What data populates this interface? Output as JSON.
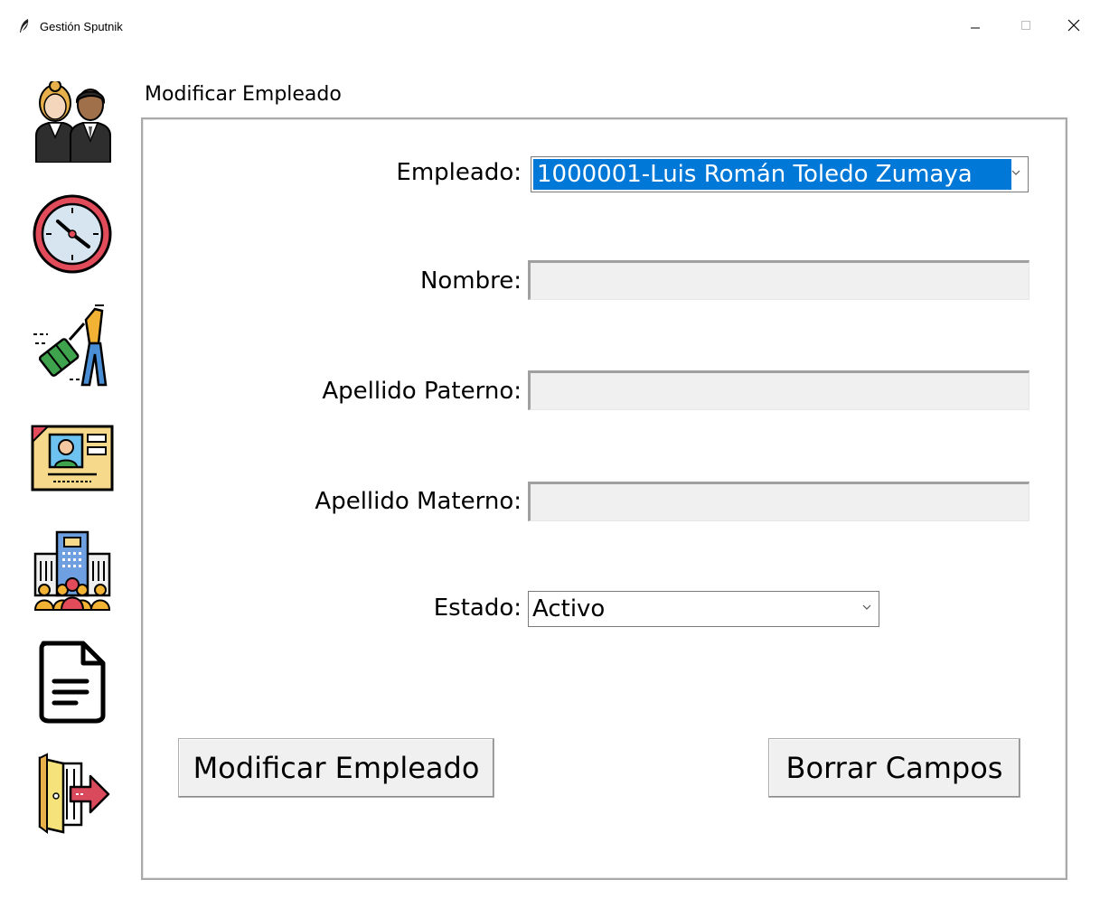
{
  "window": {
    "title": "Gestión Sputnik",
    "minimize_glyph": "–",
    "maximize_glyph": "□",
    "close_glyph": "✕"
  },
  "sidebar": {
    "items": [
      {
        "icon": "employees-icon"
      },
      {
        "icon": "clock-icon"
      },
      {
        "icon": "travel-icon"
      },
      {
        "icon": "id-card-icon"
      },
      {
        "icon": "company-building-icon"
      },
      {
        "icon": "document-icon"
      },
      {
        "icon": "exit-door-icon"
      }
    ]
  },
  "form": {
    "group_title": "Modificar Empleado",
    "employee_label": "Empleado:",
    "employee_value": "1000001-Luis Román Toledo Zumaya",
    "nombre_label": "Nombre:",
    "nombre_value": "",
    "apellido_paterno_label": "Apellido Paterno:",
    "apellido_paterno_value": "",
    "apellido_materno_label": "Apellido Materno:",
    "apellido_materno_value": "",
    "estado_label": "Estado:",
    "estado_value": "Activo",
    "modify_button": "Modificar Empleado",
    "clear_button": "Borrar Campos"
  },
  "colors": {
    "selection": "#0078d7",
    "entry_bg": "#f0f0f0",
    "button_bg": "#f0f0f0"
  }
}
